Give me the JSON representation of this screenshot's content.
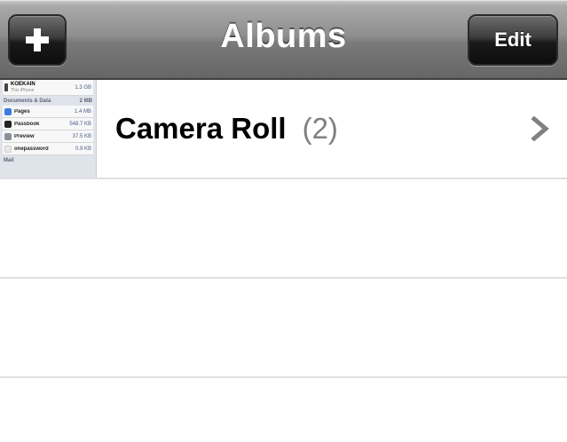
{
  "navbar": {
    "title": "Albums",
    "add_icon": "plus-icon",
    "edit_label": "Edit"
  },
  "albums": [
    {
      "name": "Camera Roll",
      "count": "(2)",
      "chevron_icon": "chevron-right-icon",
      "thumbnail": {
        "device_name": "KOEKAIN",
        "device_sub": "This iPhone",
        "device_size": "1.3 GB",
        "section_title": "Documents & Data",
        "section_size": "2 MB",
        "apps": [
          {
            "name": "Pages",
            "size": "1.4 MB",
            "color": "#3b7be0"
          },
          {
            "name": "Passbook",
            "size": "548.7 KB",
            "color": "#222222"
          },
          {
            "name": "Preview",
            "size": "37.5 KB",
            "color": "#8a8f99"
          },
          {
            "name": "onepassword",
            "size": "0.9 KB",
            "color": "#e8e8e8"
          }
        ],
        "footer_section": "Mail"
      }
    }
  ],
  "colors": {
    "navbar_top": "#a9a9a9",
    "navbar_bottom": "#666666",
    "button_dark": "#0d0d0d",
    "count_gray": "#808080",
    "separator": "#e0e0e0",
    "chevron": "#808080"
  }
}
